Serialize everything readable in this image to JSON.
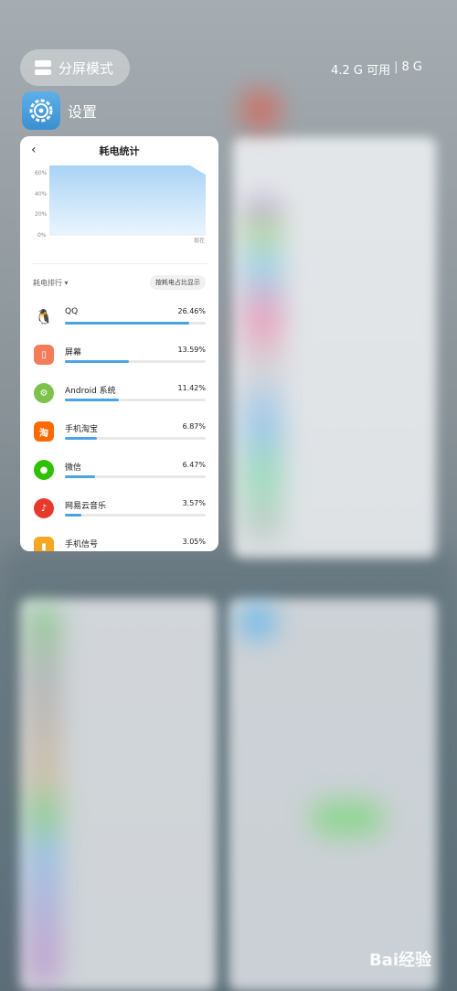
{
  "topbar": {
    "split_label": "分屏模式",
    "mem_available": "4.2 G 可用",
    "mem_total": "8 G"
  },
  "app": {
    "name": "设置"
  },
  "card": {
    "title": "耗电统计",
    "chart": {
      "y_ticks": [
        "60%",
        "40%",
        "20%",
        "0%"
      ],
      "x_label": "现在"
    },
    "rank_label": "耗电排行",
    "toggle_label": "按耗电占比显示",
    "items": [
      {
        "name": "QQ",
        "pct": "26.46%",
        "value": 26.46,
        "icon": "qq-icon",
        "color": "#ffffff"
      },
      {
        "name": "屏幕",
        "pct": "13.59%",
        "value": 13.59,
        "icon": "screen-icon",
        "color": "#f47c5a"
      },
      {
        "name": "Android 系统",
        "pct": "11.42%",
        "value": 11.42,
        "icon": "android-gear-icon",
        "color": "#7cc24b"
      },
      {
        "name": "手机淘宝",
        "pct": "6.87%",
        "value": 6.87,
        "icon": "taobao-icon",
        "color": "#ff6a00"
      },
      {
        "name": "微信",
        "pct": "6.47%",
        "value": 6.47,
        "icon": "wechat-icon",
        "color": "#2dc100"
      },
      {
        "name": "网易云音乐",
        "pct": "3.57%",
        "value": 3.57,
        "icon": "netease-music-icon",
        "color": "#e8392f"
      },
      {
        "name": "手机信号",
        "pct": "3.05%",
        "value": 3.05,
        "icon": "signal-icon",
        "color": "#f5a623"
      }
    ]
  },
  "watermark": {
    "text": "Bai经验"
  }
}
